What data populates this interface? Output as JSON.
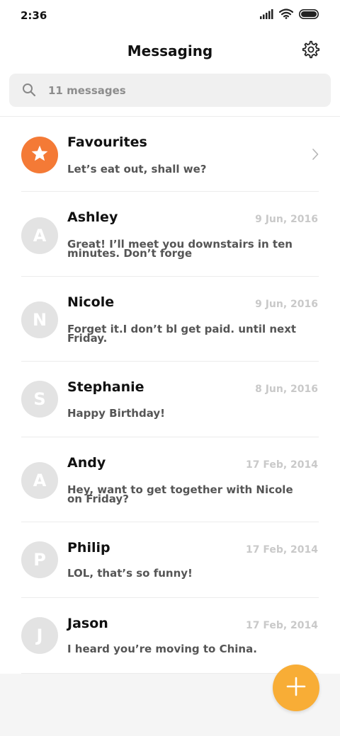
{
  "status_bar": {
    "time": "2:36"
  },
  "header": {
    "title": "Messaging",
    "settings_icon": "gear-icon"
  },
  "search": {
    "placeholder": "11 messages",
    "icon": "search-icon"
  },
  "favourites": {
    "name": "Favourites",
    "preview": "Let’s eat out, shall we?",
    "icon": "star-icon",
    "color": "#f47a36"
  },
  "conversations": [
    {
      "initial": "A",
      "name": "Ashley",
      "date": "9 Jun, 2016",
      "preview": "Great! I’ll meet you downstairs in ten minutes. Don’t forge"
    },
    {
      "initial": "N",
      "name": "Nicole",
      "date": "9 Jun, 2016",
      "preview": "Forget it.I don’t bl get paid. until next Friday."
    },
    {
      "initial": "S",
      "name": "Stephanie",
      "date": "8 Jun, 2016",
      "preview": "Happy Birthday!"
    },
    {
      "initial": "A",
      "name": "Andy",
      "date": "17 Feb, 2014",
      "preview": "Hey, want to get together with Nicole on Friday?"
    },
    {
      "initial": "P",
      "name": "Philip",
      "date": "17 Feb, 2014",
      "preview": "LOL, that’s so funny!"
    },
    {
      "initial": "J",
      "name": "Jason",
      "date": "17 Feb, 2014",
      "preview": "I heard you’re moving to China."
    }
  ],
  "fab": {
    "icon": "plus-icon",
    "color": "#f8ad36"
  }
}
